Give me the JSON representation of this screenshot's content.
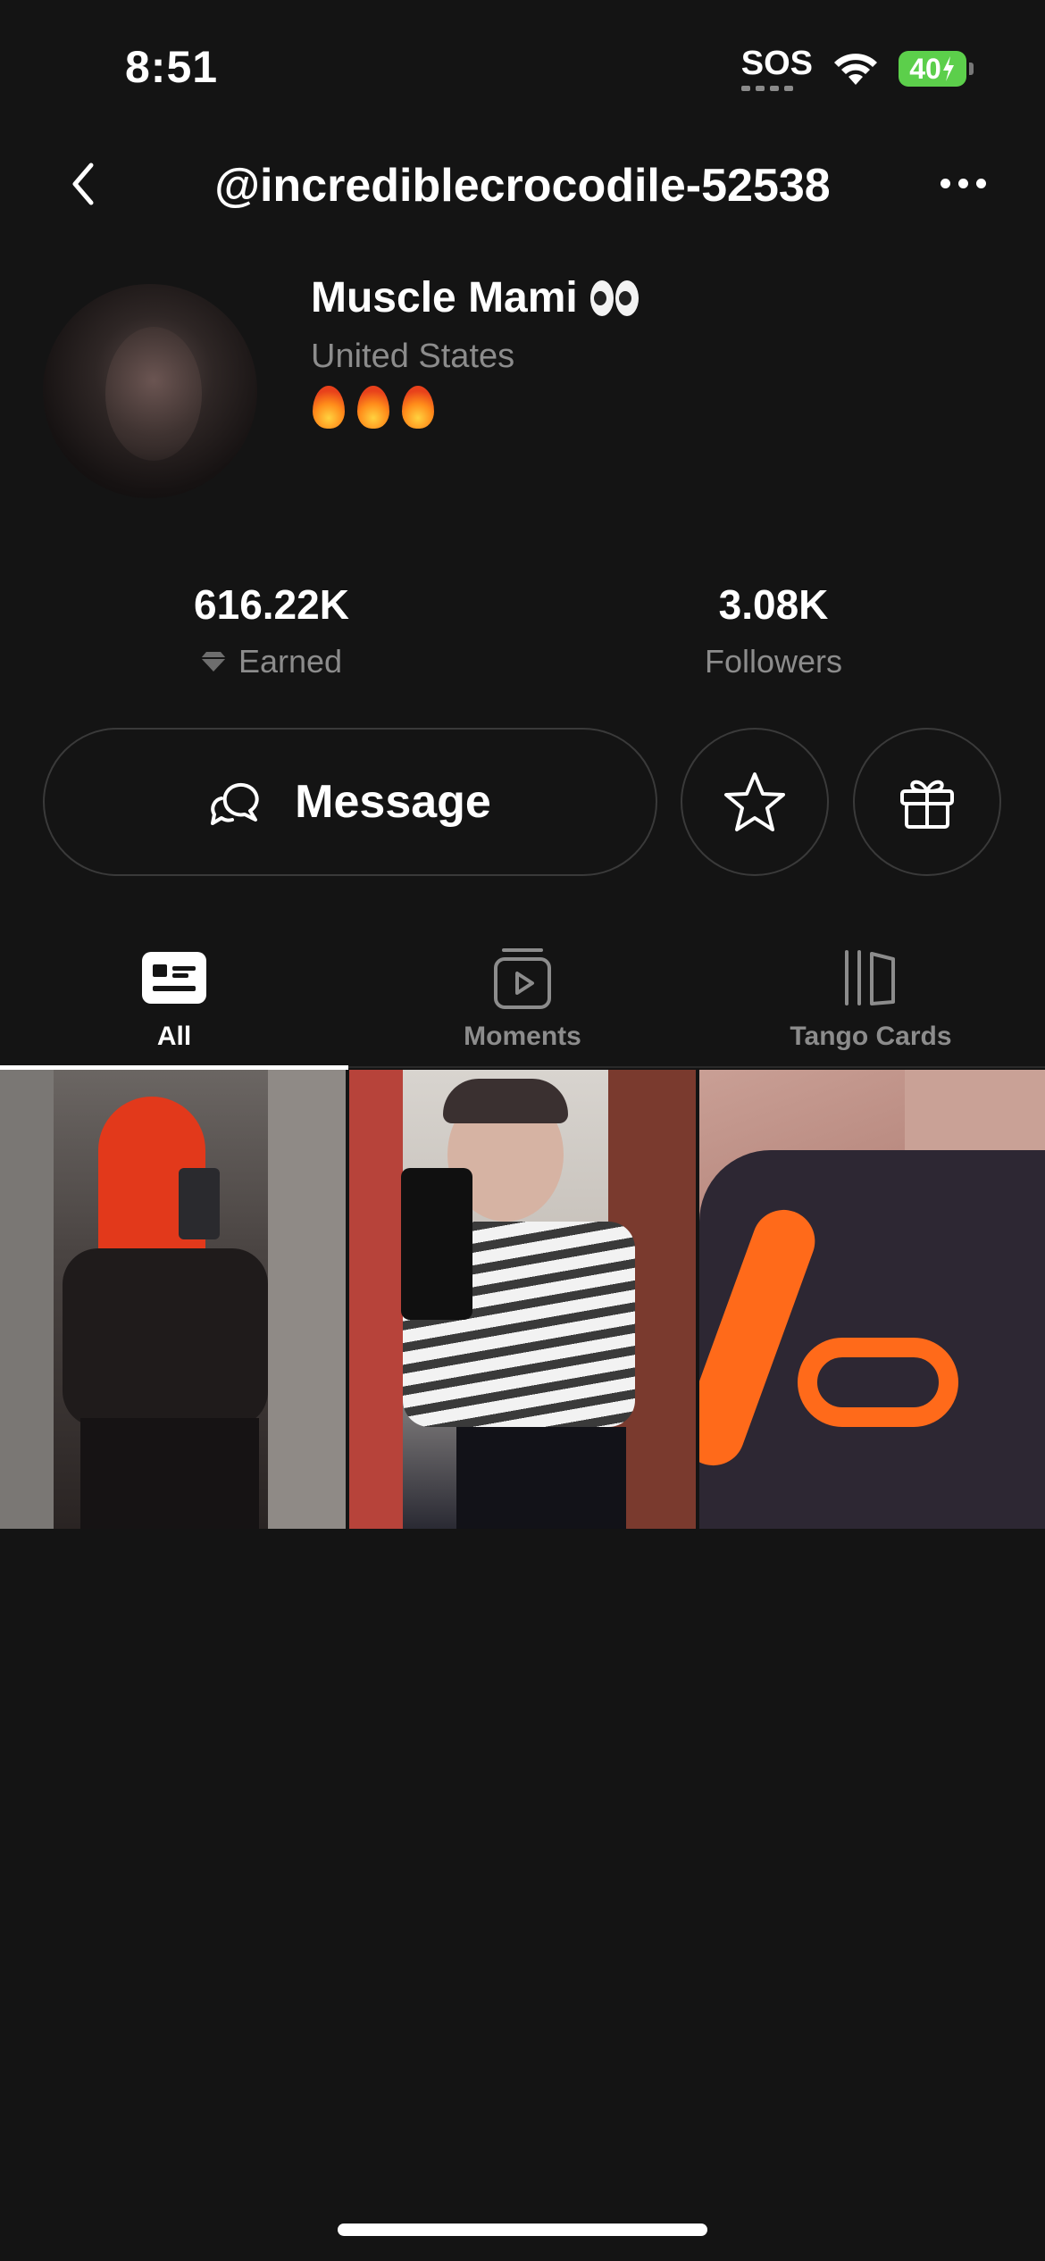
{
  "status_bar": {
    "time": "8:51",
    "sos": "SOS",
    "battery": "40",
    "icons": [
      "sos-icon",
      "wifi-icon",
      "battery-charging-icon"
    ]
  },
  "header": {
    "title": "@incrediblecrocodile-52538",
    "back_icon": "chevron-left-icon",
    "more_icon": "ellipsis-icon"
  },
  "profile": {
    "name": "Muscle Mami",
    "name_emoji": "eyes-emoji",
    "country": "United States",
    "bio_emoji": [
      "fire-emoji",
      "fire-emoji",
      "fire-emoji"
    ]
  },
  "stats": {
    "earned": {
      "value": "616.22K",
      "label": "Earned",
      "icon": "diamond-icon"
    },
    "followers": {
      "value": "3.08K",
      "label": "Followers"
    }
  },
  "actions": {
    "message_label": "Message",
    "message_icon": "chat-bubbles-icon",
    "star_icon": "star-icon",
    "gift_icon": "gift-icon"
  },
  "tabs": [
    {
      "label": "All",
      "icon": "id-card-icon",
      "active": true
    },
    {
      "label": "Moments",
      "icon": "play-square-icon",
      "active": false
    },
    {
      "label": "Tango Cards",
      "icon": "cards-icon",
      "active": false
    }
  ],
  "grid": {
    "tiles": [
      {
        "name": "photo-tile-1"
      },
      {
        "name": "photo-tile-2"
      },
      {
        "name": "photo-tile-3"
      }
    ]
  },
  "colors": {
    "background": "#141414",
    "text_primary": "#ffffff",
    "text_secondary": "#8c8c8c",
    "border": "#3a3a3a",
    "battery": "#5ccf4b"
  }
}
